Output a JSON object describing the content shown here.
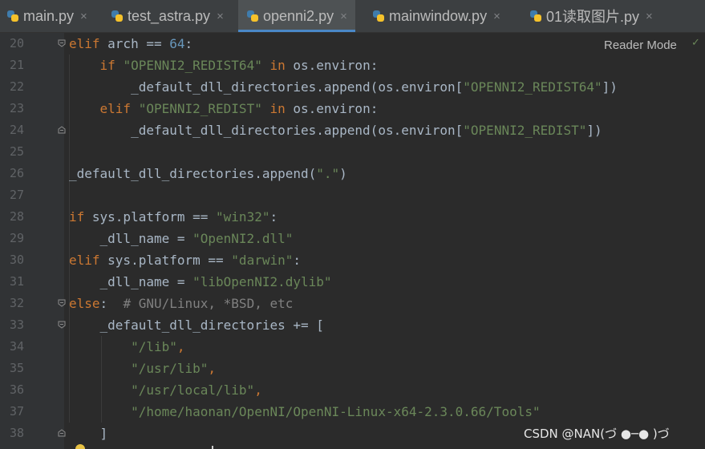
{
  "tabs": [
    {
      "label": "main.py",
      "icon": "python-file-icon",
      "active": false
    },
    {
      "label": "test_astra.py",
      "icon": "python-file-icon",
      "active": false
    },
    {
      "label": "openni2.py",
      "icon": "python-file-icon",
      "active": true
    },
    {
      "label": "mainwindow.py",
      "icon": "python-file-icon",
      "active": false
    },
    {
      "label": "01读取图片.py",
      "icon": "python-file-icon",
      "active": false
    }
  ],
  "close_glyph": "×",
  "reader_mode": "Reader Mode",
  "check_glyph": "✓",
  "watermark": "CSDN @NAN(づ ●─● )づ",
  "colors": {
    "keyword": "#cc7832",
    "string": "#6a8759",
    "number": "#6897bb",
    "comment": "#808080",
    "text": "#a9b7c6",
    "background": "#2b2b2b"
  },
  "lines": [
    {
      "num": "20",
      "fold": "open",
      "tokens": [
        {
          "t": "elif",
          "c": "kw"
        },
        {
          "t": " arch == "
        },
        {
          "t": "64",
          "c": "num"
        },
        {
          "t": ":"
        }
      ]
    },
    {
      "num": "21",
      "tokens": [
        {
          "t": "    "
        },
        {
          "t": "if",
          "c": "kw"
        },
        {
          "t": " "
        },
        {
          "t": "\"OPENNI2_REDIST64\"",
          "c": "str"
        },
        {
          "t": " "
        },
        {
          "t": "in",
          "c": "kw"
        },
        {
          "t": " os.environ:"
        }
      ]
    },
    {
      "num": "22",
      "tokens": [
        {
          "t": "        _default_dll_directories.append(os.environ["
        },
        {
          "t": "\"OPENNI2_REDIST64\"",
          "c": "str"
        },
        {
          "t": "])"
        }
      ]
    },
    {
      "num": "23",
      "tokens": [
        {
          "t": "    "
        },
        {
          "t": "elif",
          "c": "kw"
        },
        {
          "t": " "
        },
        {
          "t": "\"OPENNI2_REDIST\"",
          "c": "str"
        },
        {
          "t": " "
        },
        {
          "t": "in",
          "c": "kw"
        },
        {
          "t": " os.environ:"
        }
      ]
    },
    {
      "num": "24",
      "fold": "close",
      "tokens": [
        {
          "t": "        _default_dll_directories.append(os.environ["
        },
        {
          "t": "\"OPENNI2_REDIST\"",
          "c": "str"
        },
        {
          "t": "])"
        }
      ]
    },
    {
      "num": "25",
      "tokens": []
    },
    {
      "num": "26",
      "tokens": [
        {
          "t": "_default_dll_directories.append("
        },
        {
          "t": "\".\"",
          "c": "str"
        },
        {
          "t": ")"
        }
      ]
    },
    {
      "num": "27",
      "tokens": []
    },
    {
      "num": "28",
      "tokens": [
        {
          "t": "if",
          "c": "kw"
        },
        {
          "t": " sys.platform == "
        },
        {
          "t": "\"win32\"",
          "c": "str"
        },
        {
          "t": ":"
        }
      ]
    },
    {
      "num": "29",
      "tokens": [
        {
          "t": "    _dll_name = "
        },
        {
          "t": "\"OpenNI2.dll\"",
          "c": "str"
        }
      ]
    },
    {
      "num": "30",
      "tokens": [
        {
          "t": "elif",
          "c": "kw"
        },
        {
          "t": " sys.platform == "
        },
        {
          "t": "\"darwin\"",
          "c": "str"
        },
        {
          "t": ":"
        }
      ]
    },
    {
      "num": "31",
      "tokens": [
        {
          "t": "    _dll_name = "
        },
        {
          "t": "\"libOpenNI2.dylib\"",
          "c": "str"
        }
      ]
    },
    {
      "num": "32",
      "fold": "open",
      "tokens": [
        {
          "t": "else",
          "c": "kw"
        },
        {
          "t": ":  "
        },
        {
          "t": "# GNU/Linux, *BSD, etc",
          "c": "cmt"
        }
      ]
    },
    {
      "num": "33",
      "fold": "open",
      "tokens": [
        {
          "t": "    _default_dll_directories += ["
        }
      ]
    },
    {
      "num": "34",
      "tokens": [
        {
          "t": "        "
        },
        {
          "t": "\"/lib\"",
          "c": "str"
        },
        {
          "t": ",",
          "c": "kw"
        }
      ]
    },
    {
      "num": "35",
      "tokens": [
        {
          "t": "        "
        },
        {
          "t": "\"/usr/lib\"",
          "c": "str"
        },
        {
          "t": ",",
          "c": "kw"
        }
      ]
    },
    {
      "num": "36",
      "tokens": [
        {
          "t": "        "
        },
        {
          "t": "\"/usr/local/lib\"",
          "c": "str"
        },
        {
          "t": ",",
          "c": "kw"
        }
      ]
    },
    {
      "num": "37",
      "tokens": [
        {
          "t": "        "
        },
        {
          "t": "\"/home/haonan/OpenNI/OpenNI-Linux-x64-2.3.0.66/Tools\"",
          "c": "str"
        }
      ]
    },
    {
      "num": "38",
      "fold": "close",
      "tokens": [
        {
          "t": "    ]"
        }
      ]
    }
  ]
}
